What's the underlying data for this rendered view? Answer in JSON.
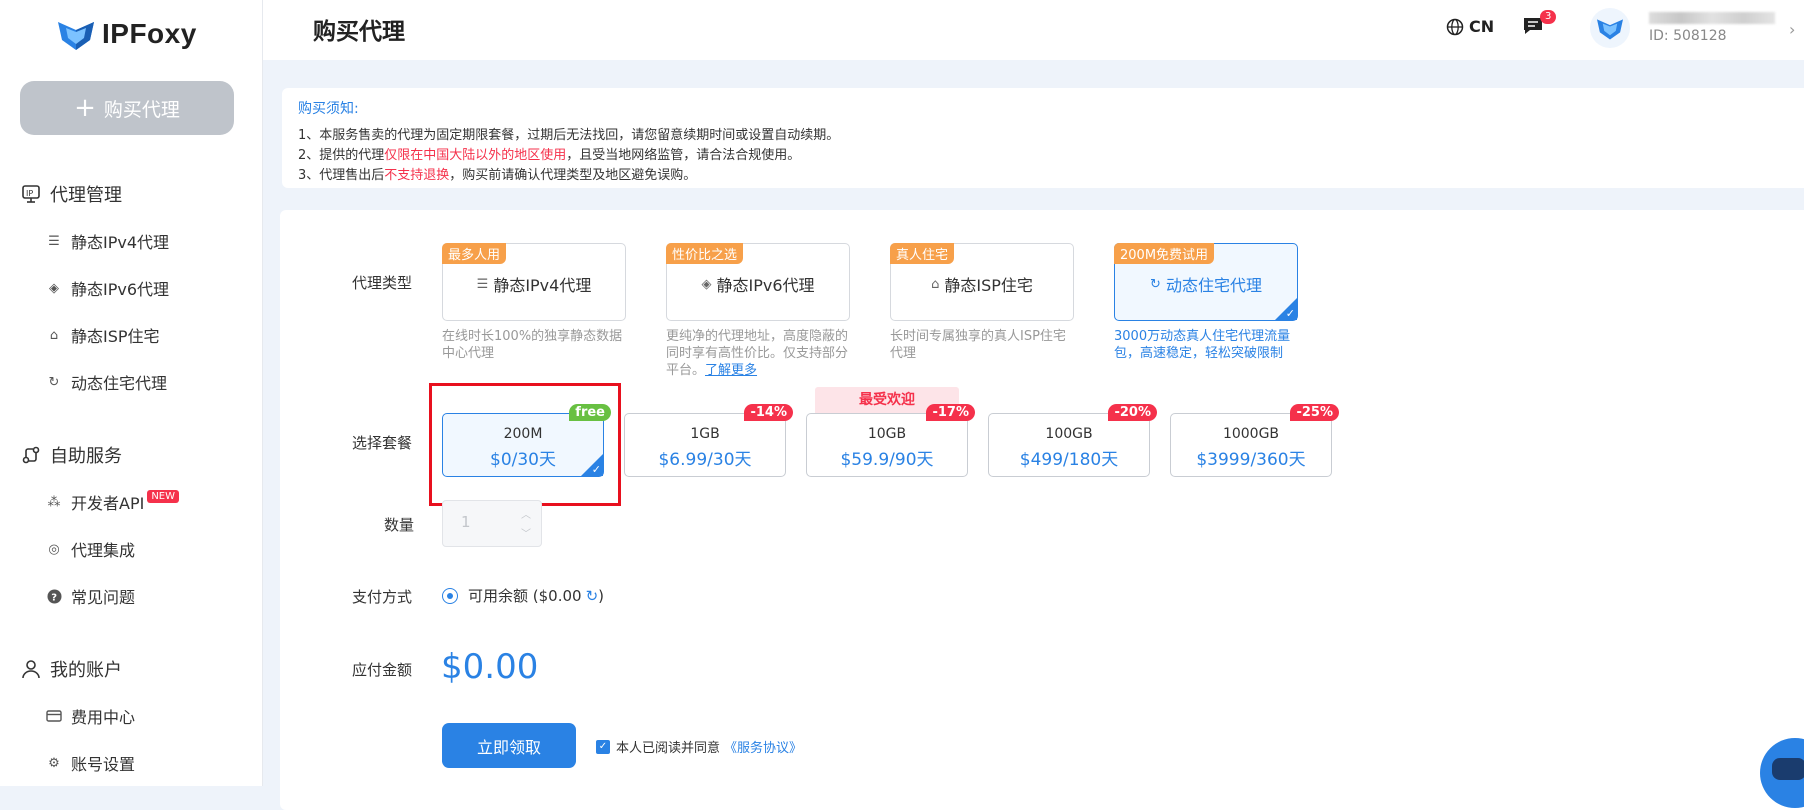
{
  "brand": {
    "name": "IPFoxy",
    "accent": "#2a82e4"
  },
  "sidebar": {
    "buy_button": "购买代理",
    "groups": [
      {
        "label": "代理管理",
        "icon": "ip-icon",
        "items": [
          {
            "label": "静态IPv4代理",
            "icon": "server-icon"
          },
          {
            "label": "静态IPv6代理",
            "icon": "layers-icon"
          },
          {
            "label": "静态ISP住宅",
            "icon": "home-icon"
          },
          {
            "label": "动态住宅代理",
            "icon": "rotate-icon"
          }
        ]
      },
      {
        "label": "自助服务",
        "icon": "route-icon",
        "items": [
          {
            "label": "开发者API",
            "icon": "api-icon",
            "badge": "NEW"
          },
          {
            "label": "代理集成",
            "icon": "fingerprint-icon"
          },
          {
            "label": "常见问题",
            "icon": "question-icon"
          }
        ]
      },
      {
        "label": "我的账户",
        "icon": "user-icon",
        "items": [
          {
            "label": "费用中心",
            "icon": "card-icon"
          },
          {
            "label": "账号设置",
            "icon": "gear-icon"
          }
        ]
      }
    ]
  },
  "header": {
    "title": "购买代理",
    "lang": "CN",
    "message_count": "3",
    "user_id": "ID: 508128"
  },
  "notice": {
    "title": "购买须知:",
    "line1": "1、本服务售卖的代理为固定期限套餐，过期后无法找回，请您留意续期时间或设置自动续期。",
    "line2_a": "2、提供的代理",
    "line2_red": "仅限在中国大陆以外的地区使用",
    "line2_b": "，且受当地网络监管，请合法合规使用。",
    "line3_a": "3、代理售出后",
    "line3_red": "不支持退换",
    "line3_b": "，购买前请确认代理类型及地区避免误购。"
  },
  "form": {
    "type_label": "代理类型",
    "package_label": "选择套餐",
    "quantity_label": "数量",
    "payment_label": "支付方式",
    "amount_label": "应付金额",
    "proxy_types": [
      {
        "tag": "最多人用",
        "name": "静态IPv4代理",
        "desc": "在线时长100%的独享静态数据中心代理",
        "selected": false
      },
      {
        "tag": "性价比之选",
        "name": "静态IPv6代理",
        "desc": "更纯净的代理地址，高度隐蔽的同时享有高性价比。仅支持部分平台。",
        "more": "了解更多",
        "selected": false
      },
      {
        "tag": "真人住宅",
        "name": "静态ISP住宅",
        "desc": "长时间专属独享的真人ISP住宅代理",
        "selected": false
      },
      {
        "tag": "200M免费试用",
        "name": "动态住宅代理",
        "desc": "3000万动态真人住宅代理流量包，高速稳定，轻松突破限制",
        "selected": true
      }
    ],
    "popular_label": "最受欢迎",
    "packages": [
      {
        "size": "200M",
        "price": "$0/30天",
        "badge": "free",
        "selected": true
      },
      {
        "size": "1GB",
        "price": "$6.99/30天",
        "badge": "-14%",
        "selected": false
      },
      {
        "size": "10GB",
        "price": "$59.9/90天",
        "badge": "-17%",
        "selected": false
      },
      {
        "size": "100GB",
        "price": "$499/180天",
        "badge": "-20%",
        "selected": false
      },
      {
        "size": "1000GB",
        "price": "$3999/360天",
        "badge": "-25%",
        "selected": false
      }
    ],
    "quantity": "1",
    "payment_option": "可用余额 ($0.00",
    "payment_close": ")",
    "amount": "$0.00",
    "submit": "立即领取",
    "agree_text": "本人已阅读并同意",
    "agree_link": "《服务协议》"
  }
}
